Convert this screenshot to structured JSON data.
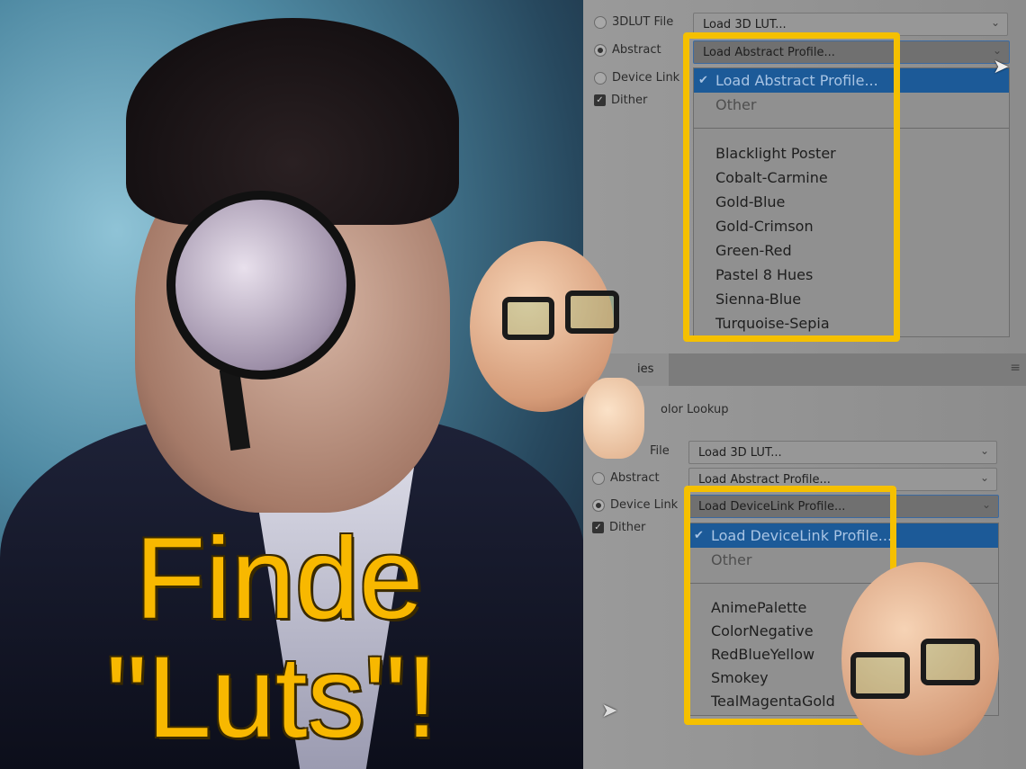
{
  "headline": {
    "line1": "Finde",
    "line2": "\"Luts\"!",
    "color": "#f8b800"
  },
  "top_panel": {
    "options": [
      {
        "label": "3DLUT File",
        "type": "radio",
        "selected": false
      },
      {
        "label": "Abstract",
        "type": "radio",
        "selected": true
      },
      {
        "label": "Device Link",
        "type": "radio",
        "selected": false
      },
      {
        "label": "Dither",
        "type": "checkbox",
        "checked": true
      }
    ],
    "lut_select": "Load 3D LUT...",
    "abstract_select": "Load Abstract Profile...",
    "menu": {
      "selected": "Load Abstract Profile...",
      "other": "Other",
      "items": [
        "Blacklight Poster",
        "Cobalt-Carmine",
        "Gold-Blue",
        "Gold-Crimson",
        "Green-Red",
        "Pastel 8 Hues",
        "Sienna-Blue",
        "Turquoise-Sepia"
      ]
    }
  },
  "bottom_panel": {
    "tab": "ies",
    "title": "olor Lookup",
    "options": [
      {
        "label": "File",
        "type": "radio",
        "selected": false
      },
      {
        "label": "Abstract",
        "type": "radio",
        "selected": false
      },
      {
        "label": "Device Link",
        "type": "radio",
        "selected": true
      },
      {
        "label": "Dither",
        "type": "checkbox",
        "checked": true
      }
    ],
    "lut_select": "Load 3D LUT...",
    "abstract_select": "Load Abstract Profile...",
    "devicelink_select": "Load DeviceLink Profile...",
    "menu": {
      "selected": "Load DeviceLink Profile...",
      "other": "Other",
      "items": [
        "AnimePalette",
        "ColorNegative",
        "RedBlueYellow",
        "Smokey",
        "TealMagentaGold"
      ]
    }
  },
  "colors": {
    "highlight": "#f5c000",
    "menu_selected": "#1c5a98"
  }
}
